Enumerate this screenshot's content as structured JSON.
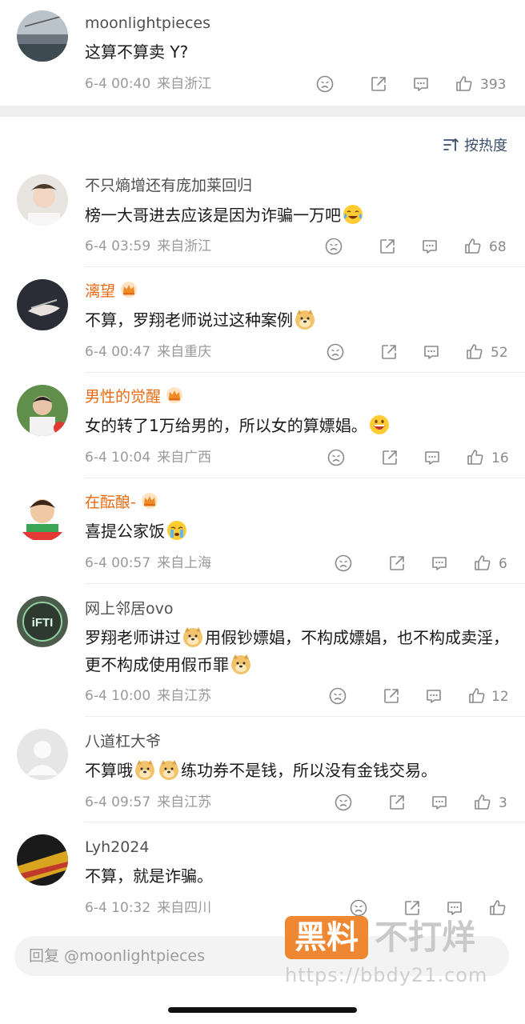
{
  "top_comment": {
    "username": "moonlightpieces",
    "text": "这算不算卖 Y?",
    "time": "6-4 00:40",
    "location": "来自浙江",
    "likes": "393"
  },
  "sort_label": "按热度",
  "replies": [
    {
      "username": "不只熵增还有庞加莱回归",
      "vip": false,
      "text": "榜一大哥进去应该是因为诈骗一万吧",
      "emoji_after": "laugh-cry-emoji",
      "time": "6-4 03:59",
      "location": "来自浙江",
      "likes": "68"
    },
    {
      "username": "漓望",
      "vip": true,
      "text": "不算，罗翔老师说过这种案例",
      "emoji_after": "doge-emoji",
      "time": "6-4 00:47",
      "location": "来自重庆",
      "likes": "52"
    },
    {
      "username": "男性的觉醒",
      "vip": true,
      "text": "女的转了1万给男的，所以女的算嫖娼。",
      "emoji_after": "grin-emoji",
      "time": "6-4 10:04",
      "location": "来自广西",
      "likes": "16"
    },
    {
      "username": "在酝酿-",
      "vip": true,
      "text": "喜提公家饭",
      "emoji_after": "crying-emoji",
      "time": "6-4 00:57",
      "location": "来自上海",
      "likes": "6"
    },
    {
      "username": "网上邻居ovo",
      "vip": false,
      "text_part1": "罗翔老师讲过",
      "text_part2": "用假钞嫖娼，不构成嫖娼，也不构成卖淫，更不构成使用假币罪",
      "time": "6-4 10:00",
      "location": "来自江苏",
      "likes": "12"
    },
    {
      "username": "八道杠大爷",
      "vip": false,
      "text_part1": "不算哦",
      "text_part2": "练功券不是钱，所以没有金钱交易。",
      "time": "6-4 09:57",
      "location": "来自江苏",
      "likes": "3"
    },
    {
      "username": "Lyh2024",
      "vip": false,
      "text": "不算，就是诈骗。",
      "time": "6-4 10:32",
      "location": "来自四川",
      "likes": ""
    }
  ],
  "reply_placeholder": "回复 @moonlightpieces",
  "watermark": {
    "badge": "黑料",
    "text": "不打烊",
    "url": "https://bbdy21.com"
  },
  "colors": {
    "vip_name": "#e86a12",
    "meta": "#9a9a9a",
    "sort": "#3a4e6a",
    "watermark_badge": "#ef7d22"
  }
}
